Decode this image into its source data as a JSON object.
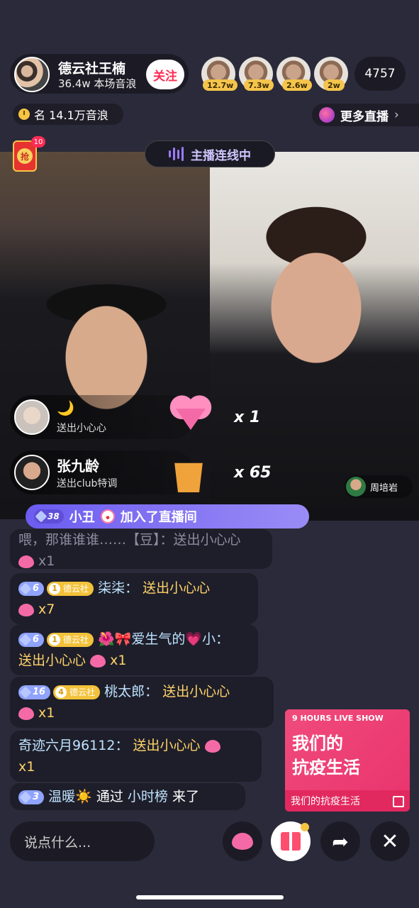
{
  "host": {
    "name": "德云社王楠",
    "subtitle": "36.4w 本场音浪",
    "follow_label": "关注"
  },
  "viewers": [
    {
      "badge": "12.7w"
    },
    {
      "badge": "7.3w"
    },
    {
      "badge": "2.6w"
    },
    {
      "badge": "2w"
    }
  ],
  "viewer_count": "4757",
  "rank_text": "名 14.1万音浪",
  "more_live_label": "更多直播",
  "link_status": "主播连线中",
  "red_packet": {
    "label": "抢",
    "count": "10"
  },
  "guest": {
    "name": "周培岩"
  },
  "gift_banners": [
    {
      "sender": "🌙",
      "action": "送出小心心",
      "multiplier": "x 1"
    },
    {
      "sender": "张九龄",
      "action": "送出club特调",
      "multiplier": "x 65"
    }
  ],
  "join_banner": {
    "level": "38",
    "user": "小丑",
    "text": "加入了直播间"
  },
  "chat": [
    {
      "text": "喂，那谁谁谁……【豆】：送出小心心",
      "suffix": "x1"
    },
    {
      "level": "6",
      "club_level": "1",
      "club": "德云社",
      "user": "柒柒：",
      "action": "送出小心心",
      "suffix": "x7"
    },
    {
      "level": "6",
      "club_level": "1",
      "club": "德云社",
      "user": "🌺🎀爱生气的💗小：",
      "action": "送出小心心",
      "suffix": "x1"
    },
    {
      "level": "16",
      "club_level": "4",
      "club": "德云社",
      "user": "桃太郎：",
      "action": "送出小心心",
      "suffix": "x1"
    },
    {
      "user": "奇迹六月96112：",
      "action": "送出小心心",
      "suffix": "x1"
    },
    {
      "level": "3",
      "user": "温暖☀️",
      "via": "通过",
      "source": "小时榜",
      "action": "来了"
    }
  ],
  "promo": {
    "tag": "9 HOURS LIVE SHOW",
    "line1": "我们的",
    "line2": "抗疫生活",
    "footer": "我们的抗疫生活"
  },
  "bottom": {
    "input_placeholder": "说点什么..."
  }
}
